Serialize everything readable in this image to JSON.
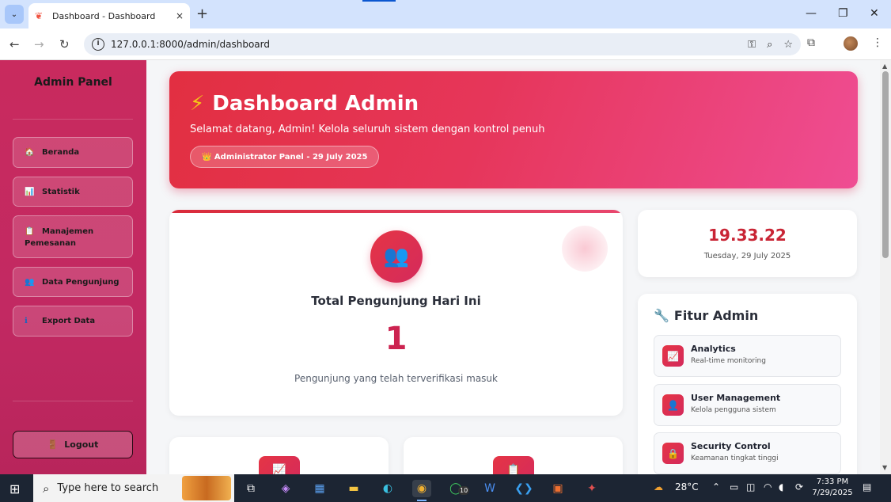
{
  "browser": {
    "tab_title": "Dashboard - Dashboard",
    "tab_close": "×",
    "new_tab": "+",
    "url": "127.0.0.1:8000/admin/dashboard",
    "window_controls": {
      "minimize": "—",
      "restore": "❐",
      "close": "✕"
    }
  },
  "sidebar": {
    "brand": "Admin Panel",
    "items": [
      {
        "icon": "home-icon",
        "glyph": "🏠",
        "label": "Beranda"
      },
      {
        "icon": "bar-chart-icon",
        "glyph": "📊",
        "label": "Statistik"
      },
      {
        "icon": "clipboard-icon",
        "glyph": "📋",
        "label": "Manajemen Pemesanan"
      },
      {
        "icon": "users-icon",
        "glyph": "👥",
        "label": "Data Pengunjung"
      },
      {
        "icon": "export-icon",
        "glyph": "ℹ",
        "label": "Export Data"
      }
    ],
    "logout": {
      "icon": "door-icon",
      "glyph": "🚪",
      "label": "Logout"
    }
  },
  "hero": {
    "title": "Dashboard Admin",
    "subtitle": "Selamat datang, Admin! Kelola seluruh sistem dengan kontrol penuh",
    "badge": "👑 Administrator Panel - 29 July 2025"
  },
  "visitors": {
    "title": "Total Pengunjung Hari Ini",
    "count": "1",
    "description": "Pengunjung yang telah terverifikasi masuk"
  },
  "clock": {
    "time": "19.33.22",
    "date": "Tuesday, 29 July 2025"
  },
  "features": {
    "title": "Fitur Admin",
    "items": [
      {
        "icon": "chart-icon",
        "glyph": "📈",
        "name": "Analytics",
        "desc": "Real-time monitoring"
      },
      {
        "icon": "user-icon",
        "glyph": "👤",
        "name": "User Management",
        "desc": "Kelola pengguna sistem"
      },
      {
        "icon": "lock-icon",
        "glyph": "🔒",
        "name": "Security Control",
        "desc": "Keamanan tingkat tinggi"
      }
    ]
  },
  "taskbar": {
    "search_placeholder": "Type here to search",
    "weather": "28°C",
    "time": "7:33 PM",
    "date": "7/29/2025",
    "whatsapp_badge": "10"
  },
  "colors": {
    "accent": "#e2334f",
    "sidebar": "#c92a5e",
    "clock_time": "#c92535"
  }
}
